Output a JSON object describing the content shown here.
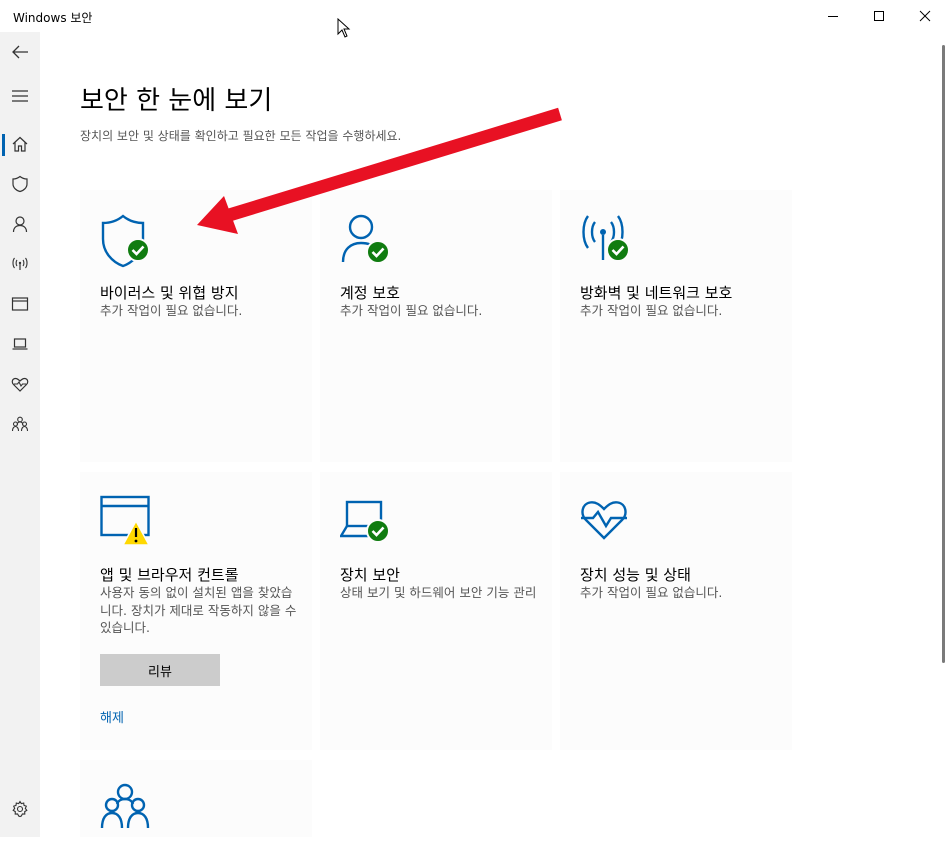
{
  "window": {
    "title": "Windows 보안"
  },
  "page": {
    "title": "보안 한 눈에 보기",
    "subtitle": "장치의 보안 및 상태를 확인하고 필요한 모든 작업을 수행하세요."
  },
  "tiles": {
    "virus": {
      "title": "바이러스 및 위협 방지",
      "desc": "추가 작업이 필요 없습니다."
    },
    "account": {
      "title": "계정 보호",
      "desc": "추가 작업이 필요 없습니다."
    },
    "firewall": {
      "title": "방화벽 및 네트워크 보호",
      "desc": "추가 작업이 필요 없습니다."
    },
    "app": {
      "title": "앱 및 브라우저 컨트롤",
      "desc": "사용자 동의 없이 설치된 앱을 찾았습니다. 장치가 제대로 작동하지 않을 수 있습니다.",
      "review_label": "리뷰",
      "dismiss_label": "해제"
    },
    "device_security": {
      "title": "장치 보안",
      "desc": "상태 보기 및 하드웨어 보안 기능 관리"
    },
    "device_health": {
      "title": "장치 성능 및 상태",
      "desc": "추가 작업이 필요 없습니다."
    }
  },
  "colors": {
    "accent": "#0063b1",
    "ok_green": "#107c10",
    "warning_yellow": "#ffd800",
    "arrow_red": "#e81123"
  }
}
